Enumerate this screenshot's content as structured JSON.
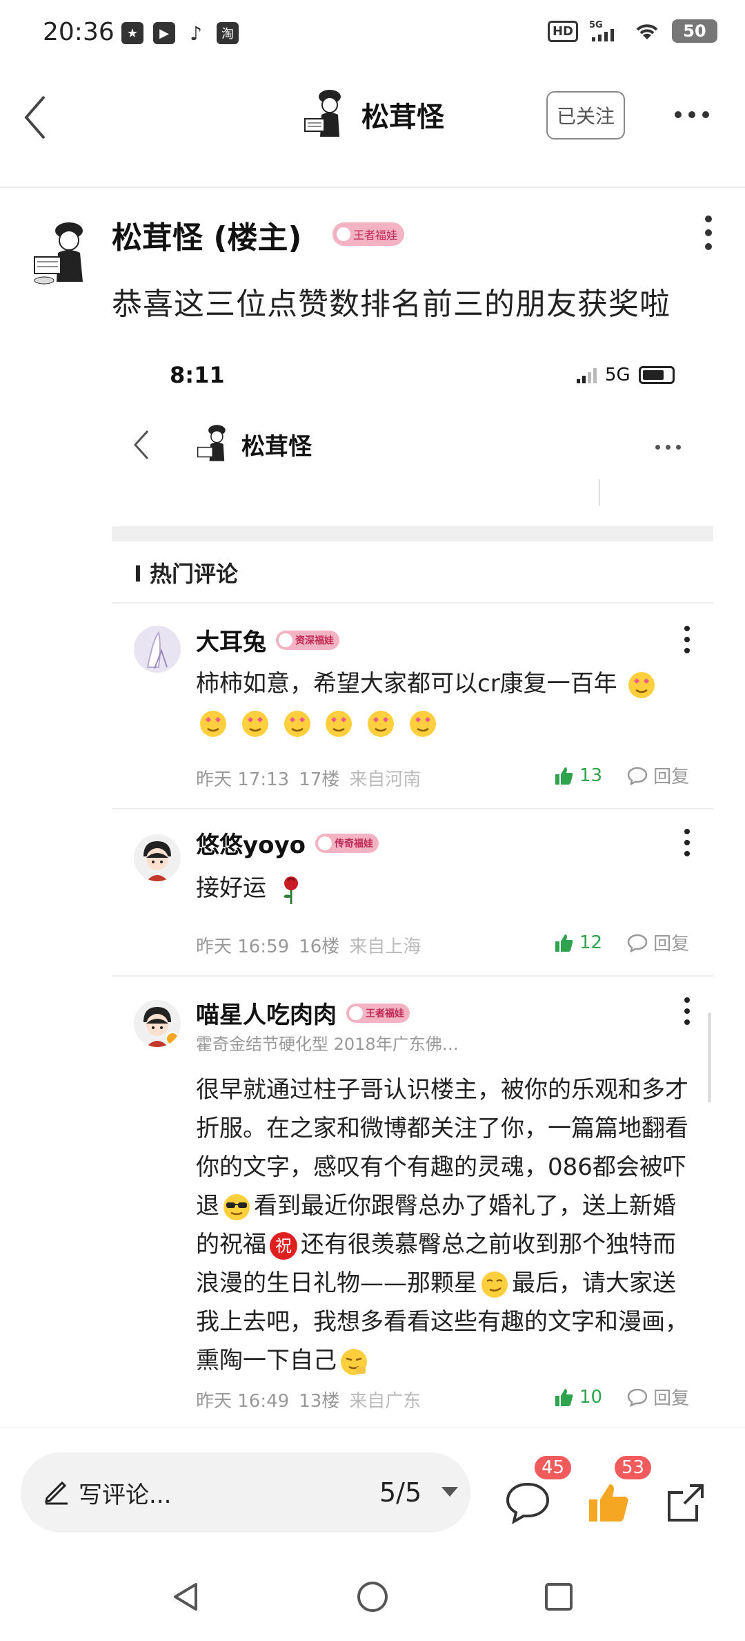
{
  "status_bar": {
    "time": "20:36",
    "app_icons": [
      "notification-icon",
      "video-icon",
      "tiktok-icon",
      "taobao-icon"
    ],
    "hd": "HD",
    "network": "5G",
    "battery": "50"
  },
  "nav": {
    "title": "松茸怪",
    "follow_label": "已关注"
  },
  "post": {
    "author": "松茸怪 (楼主)",
    "badge": "王者福娃",
    "text": "恭喜这三位点赞数排名前三的朋友获奖啦"
  },
  "embedded": {
    "time": "8:11",
    "network": "5G",
    "title": "松茸怪",
    "section_title": "I 热门评论",
    "comments": [
      {
        "name": "大耳兔",
        "badge": "资深福娃",
        "text": "柿柿如意，希望大家都可以cr康复一百年",
        "date": "昨天 17:13",
        "floor": "17楼",
        "location": "来自河南",
        "likes": "13",
        "reply": "回复"
      },
      {
        "name": "悠悠yoyo",
        "badge": "传奇福娃",
        "text": "接好运",
        "date": "昨天 16:59",
        "floor": "16楼",
        "location": "来自上海",
        "likes": "12",
        "reply": "回复"
      },
      {
        "name": "喵星人吃肉肉",
        "badge": "王者福娃",
        "subtitle": "霍奇金结节硬化型 2018年广东佛…",
        "text_parts": [
          "很早就通过柱子哥认识楼主，被你的乐观和多才折服。在之家和微博都关注了你，一篇篇地翻看你的文字，感叹有个有趣的灵魂，086都会被吓退",
          "看到最近你跟臀总办了婚礼了，送上新婚的祝福",
          "还有很羡慕臀总之前收到那个独特而浪漫的生日礼物——那颗星",
          "最后，请大家送我上去吧，我想多看看这些有趣的文字和漫画，熏陶一下自己"
        ],
        "date": "昨天 16:49",
        "floor": "13楼",
        "location": "来自广东",
        "likes": "10",
        "reply": "回复"
      }
    ]
  },
  "bottom_bar": {
    "comment_placeholder": "写评论...",
    "page": "5/5",
    "comment_count": "45",
    "like_count": "53"
  },
  "colors": {
    "like_green": "#2ea44f",
    "badge_pink": "#f3b3c2",
    "count_red": "#f15b5b",
    "like_orange": "#f5a623"
  }
}
